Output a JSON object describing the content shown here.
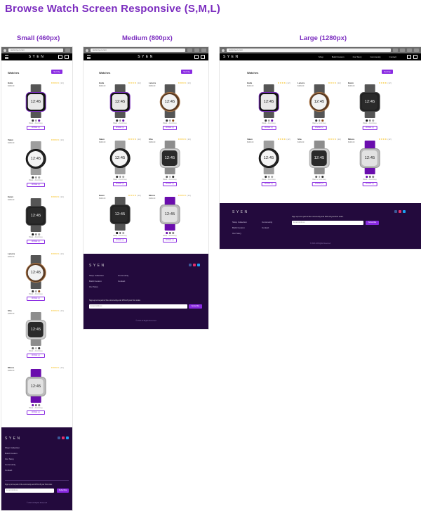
{
  "page_title": "Browse Watch Screen Responsive (S,M,L)",
  "sizes": {
    "small": "Small (460px)",
    "medium": "Medium (800px)",
    "large": "Large (1280px)"
  },
  "browser": {
    "url": "www.syen.com"
  },
  "brand": "SYEN",
  "nav_links": [
    "Shop",
    "Build Custom",
    "Our Story",
    "Community",
    "Contact"
  ],
  "main": {
    "title": "Watches",
    "sort_label": "Sort by"
  },
  "watch_time": "12:45",
  "add_label": "Wishlist (+)",
  "products": [
    {
      "name": "Halia",
      "price": "$399.00",
      "stars": "★★★★",
      "count": "(12)",
      "caption": "Black + Cool Grey"
    },
    {
      "name": "Lenora",
      "price": "$399.00",
      "stars": "★★★★",
      "count": "(12)",
      "caption": "Black + Cool Grey"
    },
    {
      "name": "Ewan",
      "price": "$399.00",
      "stars": "★★★★",
      "count": "(12)",
      "caption": "Black + Cool Grey"
    },
    {
      "name": "Valen",
      "price": "$399.00",
      "stars": "★★★★",
      "count": "(12)",
      "caption": "Black + Cool Grey"
    },
    {
      "name": "Sha",
      "price": "$399.00",
      "stars": "★★★★",
      "count": "(12)",
      "caption": "Black + Cool Grey"
    },
    {
      "name": "Mitora",
      "price": "$399.00",
      "stars": "★★★★",
      "count": "(12)",
      "caption": "Black + Cool Grey"
    }
  ],
  "footer": {
    "links": [
      "Shop Collection",
      "Build Custom",
      "Our Story",
      "Community",
      "Contact"
    ],
    "newsletter": "Sign up to be part of the community and 15% off your first order.",
    "email_placeholder": "Email Address",
    "subscribe": "Subscribe",
    "copyright": "© 2021 All Rights Reserved"
  },
  "colors": {
    "accent": "#8a2be2",
    "footer_bg": "#230a3d",
    "nav_bg": "#000000",
    "star": "#f5b800"
  },
  "icons": [
    "hamburger-icon",
    "search-icon",
    "cart-icon",
    "facebook-icon",
    "instagram-icon",
    "twitter-icon"
  ]
}
